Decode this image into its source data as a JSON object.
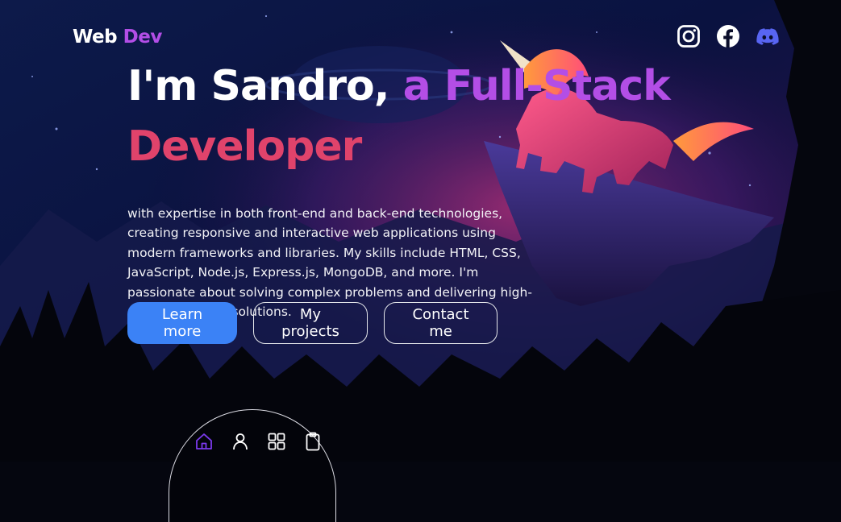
{
  "brand": {
    "part1": "Web",
    "part2": "Dev"
  },
  "socials": [
    {
      "icon": "instagram-icon"
    },
    {
      "icon": "facebook-icon"
    },
    {
      "icon": "discord-icon"
    }
  ],
  "hero": {
    "title_name": "I'm Sandro,",
    "title_role": "a Full-Stack",
    "title_role2": "Developer",
    "description": "with expertise in both front-end and back-end technologies, creating responsive and interactive web applications using modern frameworks and libraries. My skills include HTML, CSS, JavaScript, Node.js, Express.js, MongoDB, and more. I'm passionate about solving complex problems and delivering high-quality software solutions."
  },
  "buttons": {
    "learn_more": "Learn more",
    "projects": "My projects",
    "contact": "Contact me"
  },
  "dock": [
    {
      "icon": "home-icon"
    },
    {
      "icon": "user-icon"
    },
    {
      "icon": "grid-icon"
    },
    {
      "icon": "clipboard-icon"
    }
  ],
  "colors": {
    "brand_accent": "#b34ee6",
    "developer_pink": "#e0436b",
    "primary_button": "#3b82f6",
    "active_dock_icon": "#7c3aed"
  }
}
